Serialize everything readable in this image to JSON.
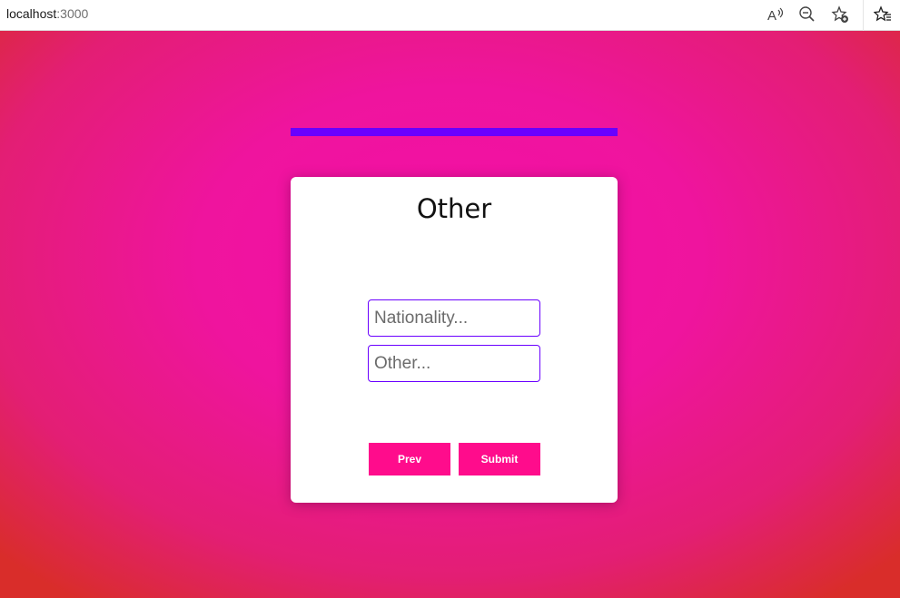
{
  "browser": {
    "url_host": "localhost",
    "url_port": ":3000",
    "icons": [
      "read-aloud-icon",
      "zoom-out-icon",
      "add-favorite-icon",
      "favorites-icon"
    ]
  },
  "progress": {
    "fraction": 1.0,
    "color": "#6a00ff"
  },
  "form": {
    "title": "Other",
    "nationality_placeholder": "Nationality...",
    "other_placeholder": "Other...",
    "prev_label": "Prev",
    "submit_label": "Submit"
  },
  "colors": {
    "accent": "#6a00ff",
    "button": "#ff0c8c",
    "background_center": "#f40fa6",
    "background_edge": "#d92d2a"
  }
}
